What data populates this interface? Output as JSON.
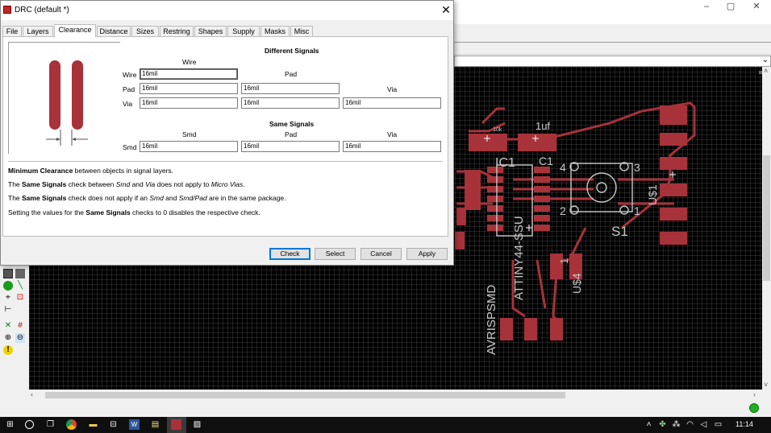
{
  "app": {
    "win_min": "–",
    "win_max": "▢",
    "win_close": "✕"
  },
  "dialog": {
    "title": "DRC (default *)",
    "close": "✕",
    "tabs": [
      {
        "label": "File"
      },
      {
        "label": "Layers"
      },
      {
        "label": "Clearance",
        "active": true
      },
      {
        "label": "Distance"
      },
      {
        "label": "Sizes"
      },
      {
        "label": "Restring"
      },
      {
        "label": "Shapes"
      },
      {
        "label": "Supply"
      },
      {
        "label": "Masks"
      },
      {
        "label": "Misc"
      }
    ],
    "different_signals": {
      "heading": "Different Signals",
      "col_wire": "Wire",
      "col_pad": "Pad",
      "col_via": "Via",
      "row_wire": "Wire",
      "row_pad": "Pad",
      "row_via": "Via",
      "wire_wire": "16mil",
      "pad_wire": "16mil",
      "pad_pad": "16mil",
      "via_wire": "16mil",
      "via_pad": "16mil",
      "via_via": "16mil"
    },
    "same_signals": {
      "heading": "Same Signals",
      "col_smd": "Smd",
      "col_pad": "Pad",
      "col_via": "Via",
      "row_smd": "Smd",
      "smd_smd": "16mil",
      "smd_pad": "16mil",
      "smd_via": "16mil"
    },
    "description": {
      "line1_bold": "Minimum Clearance",
      "line1_rest": " between objects in signal layers.",
      "line2_a": "The ",
      "line2_b": "Same Signals",
      "line2_c": " check between ",
      "line2_d": "Smd",
      "line2_e": " and ",
      "line2_f": "Via",
      "line2_g": " does not apply to ",
      "line2_h": "Micro Vias",
      "line2_i": ".",
      "line3_a": "The ",
      "line3_b": "Same Signals",
      "line3_c": " check does not apply if an ",
      "line3_d": "Smd",
      "line3_e": " and ",
      "line3_f": "Smd/Pad",
      "line3_g": " are in the same package.",
      "line4_a": "Setting the values for the ",
      "line4_b": "Same Signals",
      "line4_c": " checks to 0 disables the respective check."
    },
    "buttons": {
      "check": "Check",
      "select": "Select",
      "cancel": "Cancel",
      "apply": "Apply"
    }
  },
  "board": {
    "labels": {
      "r_val": "10k",
      "c_val": "1uf",
      "ic1": "IC1",
      "c1": "C1",
      "attiny": "ATTINY44-SSU",
      "avr": "AVRISPSMD",
      "s1": "S1",
      "u1": "U$1",
      "u4": "U$4",
      "one": "1",
      "p4": "4",
      "p3": "3",
      "p2": "2",
      "p1": "1"
    },
    "colors": {
      "copper": "#a8323a",
      "label": "#c8c8c8",
      "background": "#000000"
    }
  },
  "taskbar": {
    "clock": "11:14"
  }
}
